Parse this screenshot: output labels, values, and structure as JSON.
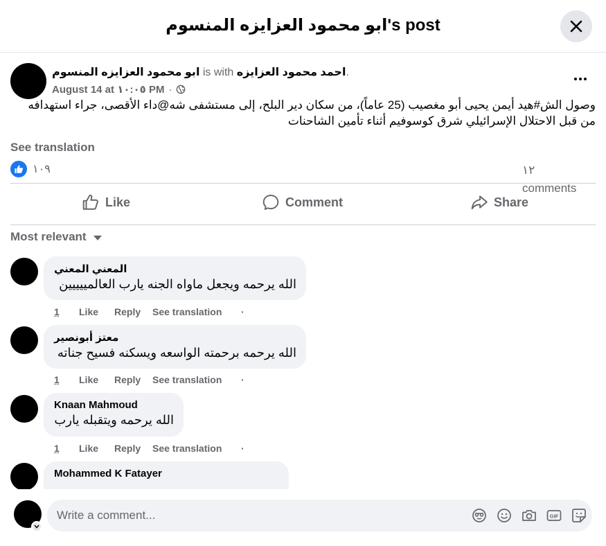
{
  "header": {
    "title": "ابو محمود العزايزه المنسوم's post"
  },
  "post": {
    "author": "ابو محمود العزايزه المنسوم",
    "with_text": "is with",
    "tagged": "احمد محمود العزايزه",
    "tagged_suffix": ".",
    "date": "August 14 at ١٠:٠٥ PM",
    "dot": "·",
    "privacy_icon": "globe-icon",
    "text": "وصول الش#هيد أيمن يحيى أبو مغصيب (25 عاماً)، من سكان دير البلح، إلى مستشفى شه@داء الأقصى، جراء استهدافه من قبل الاحتلال الإسرائيلي شرق كوسوفيم أثناء تأمين الشاحنات",
    "see_translation": "See translation",
    "reaction_count": "١٠٩",
    "comments_count": "١٢ comments"
  },
  "actions": {
    "like": "Like",
    "comment": "Comment",
    "share": "Share"
  },
  "sort": {
    "label": "Most relevant"
  },
  "comments": [
    {
      "author": "المعني المعني",
      "text": "الله يرحمه ويجعل ماواه الجنه يارب العالمييييين",
      "time": "1",
      "like": "Like",
      "reply": "Reply",
      "translate": "See translation",
      "dot": "·"
    },
    {
      "author": "معتز أبونصير",
      "text": "الله يرحمه برحمته الواسعه ويسكنه فسيح جناته",
      "time": "1",
      "like": "Like",
      "reply": "Reply",
      "translate": "See translation",
      "dot": "·"
    },
    {
      "author": "Knaan Mahmoud",
      "text": "الله يرحمه ويتقبله يارب",
      "time": "1",
      "like": "Like",
      "reply": "Reply",
      "translate": "See translation",
      "dot": "·"
    },
    {
      "author": "Mohammed K Fatayer",
      "text": "",
      "time": "",
      "like": "",
      "reply": "",
      "translate": "",
      "dot": ""
    }
  ],
  "composer": {
    "placeholder": "Write a comment..."
  },
  "colors": {
    "accent": "#1877f2",
    "muted": "#65676b",
    "bubble": "#f0f2f5"
  }
}
